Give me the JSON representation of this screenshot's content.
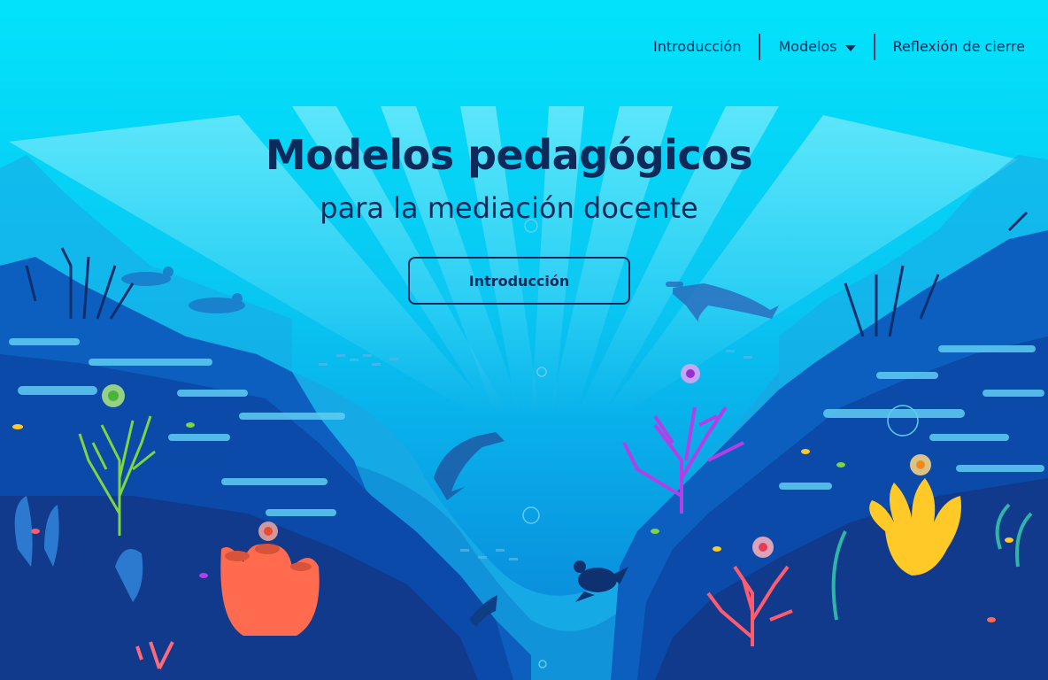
{
  "nav": {
    "items": [
      {
        "label": "Introducción"
      },
      {
        "label": "Modelos",
        "has_dropdown": true
      },
      {
        "label": "Reflexión de cierre"
      }
    ]
  },
  "hero": {
    "title": "Modelos pedagógicos",
    "subtitle": "para la mediación docente",
    "cta_label": "Introducción"
  },
  "colors": {
    "background": "#00e1fb",
    "text": "#0d2a5a",
    "coral_orange": "#ff6b4f",
    "coral_purple": "#b43ee8",
    "coral_green": "#7bd641",
    "coral_yellow": "#ffc928",
    "coral_pink": "#ff5b6e"
  }
}
